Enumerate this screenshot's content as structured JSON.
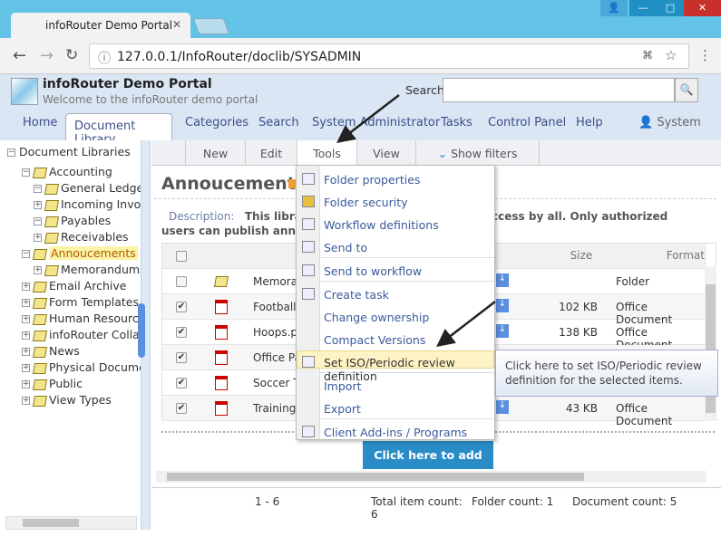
{
  "browser": {
    "tab_title": "infoRouter Demo Portal",
    "url": "127.0.0.1/InfoRouter/doclib/SYSADMIN"
  },
  "header": {
    "title": "infoRouter Demo Portal",
    "subtitle": "Welcome to the infoRouter demo portal",
    "search_label": "Search",
    "search_value": ""
  },
  "nav": {
    "items": [
      "Home",
      "Document Library",
      "Categories",
      "Search",
      "System Administrator",
      "Tasks",
      "Control Panel",
      "Help"
    ],
    "active": "Document Library",
    "user": "System"
  },
  "tree": {
    "root": "Document Libraries",
    "items": [
      {
        "label": "Accounting",
        "level": 1,
        "exp": "-"
      },
      {
        "label": "General Ledger",
        "level": 2,
        "exp": "-"
      },
      {
        "label": "Incoming Invoices",
        "level": 2,
        "exp": "+"
      },
      {
        "label": "Payables",
        "level": 2,
        "exp": "-"
      },
      {
        "label": "Receivables",
        "level": 2,
        "exp": "+"
      },
      {
        "label": "Annoucements",
        "level": 1,
        "exp": "-",
        "selected": true
      },
      {
        "label": "Memorandums",
        "level": 2,
        "exp": "+"
      },
      {
        "label": "Email Archive",
        "level": 1,
        "exp": "+"
      },
      {
        "label": "Form Templates",
        "level": 1,
        "exp": "+"
      },
      {
        "label": "Human Resources",
        "level": 1,
        "exp": "+"
      },
      {
        "label": "infoRouter Collateral",
        "level": 1,
        "exp": "+"
      },
      {
        "label": "News",
        "level": 1,
        "exp": "+"
      },
      {
        "label": "Physical Documents",
        "level": 1,
        "exp": "+"
      },
      {
        "label": "Public",
        "level": 1,
        "exp": "+"
      },
      {
        "label": "View Types",
        "level": 1,
        "exp": "+"
      }
    ]
  },
  "toolbar": {
    "new": "New",
    "edit": "Edit",
    "tools": "Tools",
    "view": "View",
    "show_filters": "Show filters"
  },
  "library": {
    "title": "Annoucements",
    "description_label": "Description:",
    "description_line1_a": "This library",
    "description_line1_b": "o read access by all. Only authorized",
    "description_line2": "users can publish announ"
  },
  "table": {
    "headers": {
      "size": "Size",
      "format": "Format"
    },
    "rows": [
      {
        "name": "Memora",
        "size": "",
        "format": "Folder",
        "checked": false,
        "type": "folder"
      },
      {
        "name": "Football",
        "size": "102 KB",
        "format": "Office Document",
        "checked": true,
        "type": "pdf"
      },
      {
        "name": "Hoops.p",
        "size": "138 KB",
        "format": "Office Document",
        "checked": true,
        "type": "pdf"
      },
      {
        "name": "Office Pa",
        "size": "",
        "format": "",
        "checked": true,
        "type": "pdf"
      },
      {
        "name": "Soccer To",
        "size": "",
        "format": "",
        "checked": true,
        "type": "pdf"
      },
      {
        "name": "Training",
        "size": "43 KB",
        "format": "Office Document",
        "checked": true,
        "type": "pdf"
      }
    ]
  },
  "menu": {
    "items": [
      "Folder properties",
      "Folder security",
      "Workflow definitions",
      "Send to",
      "Send to workflow",
      "Create task",
      "Change ownership",
      "Compact Versions",
      "Set ISO/Periodic review definition",
      "Import",
      "Export",
      "Client Add-ins / Programs"
    ],
    "highlighted": "Set ISO/Periodic review definition"
  },
  "tooltip": "Click here to set ISO/Periodic review definition for the selected items.",
  "add_files": "Click here to add files",
  "footer": {
    "range": "1 - 6",
    "total_label": "Total item count:",
    "total": "6",
    "folder_count": "Folder count: 1",
    "document_count": "Document count: 5"
  }
}
